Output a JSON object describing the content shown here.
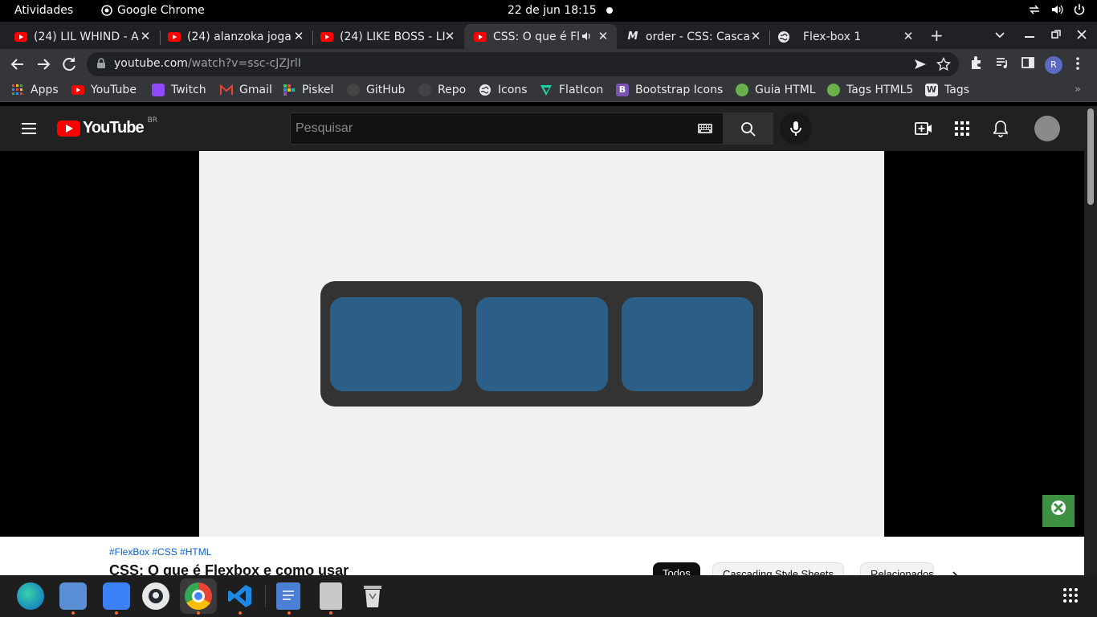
{
  "topbar": {
    "activities": "Atividades",
    "app_name": "Google Chrome",
    "clock": "22 de jun  18:15"
  },
  "tabs": [
    {
      "title": "(24) LIL WHIND - A",
      "favicon": "youtube-icon"
    },
    {
      "title": "(24) alanzoka joga",
      "favicon": "youtube-icon"
    },
    {
      "title": "(24) LIKE BOSS - LI",
      "favicon": "youtube-icon"
    },
    {
      "title": "CSS: O que é Fl",
      "favicon": "youtube-icon",
      "active": true,
      "audio": "speaker-icon"
    },
    {
      "title": "order - CSS: Cascac",
      "favicon": "mdn-icon"
    },
    {
      "title": "Flex-box 1",
      "favicon": "globe-icon"
    }
  ],
  "toolbar": {
    "url_host": "youtube.com",
    "url_path": "/watch?v=ssc-cJZJrlI",
    "profile_letter": "R"
  },
  "bookmarks": [
    {
      "label": "Apps",
      "color": "#ea4335"
    },
    {
      "label": "YouTube",
      "color": "#ff0000"
    },
    {
      "label": "Twitch",
      "color": "#9146ff"
    },
    {
      "label": "Gmail",
      "color": "#ea4335"
    },
    {
      "label": "Piskel",
      "color": "#2ecc71"
    },
    {
      "label": "GitHub",
      "color": "#444"
    },
    {
      "label": "Repo",
      "color": "#444"
    },
    {
      "label": "Icons",
      "color": "#e8eaed"
    },
    {
      "label": "FlatIcon",
      "color": "#1dd1a1"
    },
    {
      "label": "Bootstrap Icons",
      "color": "#7952b3"
    },
    {
      "label": "Guia HTML",
      "color": "#6ab04c"
    },
    {
      "label": "Tags HTML5",
      "color": "#6ab04c"
    },
    {
      "label": "Tags",
      "color": "#e8eaed"
    }
  ],
  "youtube": {
    "logo_text": "YouTube",
    "country_code": "BR",
    "search_placeholder": "Pesquisar"
  },
  "video": {
    "hashtags": "#FlexBox #CSS #HTML",
    "title": "CSS: O que é Flexbox e como usar",
    "chips": [
      "Todos",
      "Cascading Style Sheets",
      "Relacionados"
    ]
  },
  "colors": {
    "yt_red": "#ff0000",
    "flex_container": "#333333",
    "flex_item": "#2b5f87"
  }
}
